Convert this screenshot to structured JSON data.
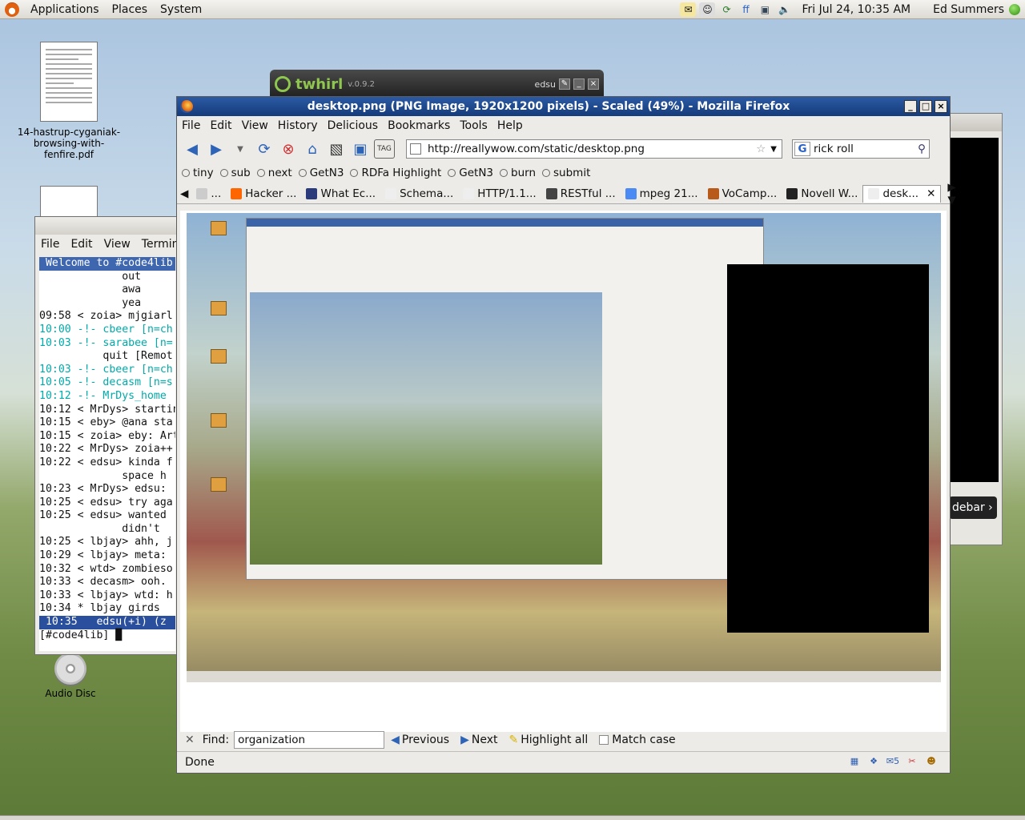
{
  "top_panel": {
    "menus": [
      "Applications",
      "Places",
      "System"
    ],
    "clock": "Fri Jul 24, 10:35 AM",
    "user": "Ed Summers"
  },
  "desktop": {
    "icons": [
      {
        "label": "14-hastrup-cyganiak-browsing-with-fenfire.pdf",
        "icon": "pdf-document-icon"
      },
      {
        "label": "Audio Disc",
        "icon": "audio-disc-icon"
      }
    ]
  },
  "twhirl": {
    "name": "twhirl",
    "version": "v.0.9.2",
    "account": "edsu"
  },
  "terminal": {
    "menus": [
      "File",
      "Edit",
      "View",
      "Terminal"
    ],
    "lines": [
      {
        "cls": "hdr",
        "text": " Welcome to #code4lib"
      },
      {
        "cls": "",
        "text": "             out"
      },
      {
        "cls": "",
        "text": "             awa"
      },
      {
        "cls": "",
        "text": "             yea"
      },
      {
        "cls": "",
        "text": "09:58 < zoia> mjgiarl"
      },
      {
        "cls": "cyan",
        "text": "10:00 -!- cbeer [n=ch"
      },
      {
        "cls": "cyan",
        "text": "10:03 -!- sarabee [n="
      },
      {
        "cls": "",
        "text": "          quit [Remot"
      },
      {
        "cls": "cyan",
        "text": "10:03 -!- cbeer [n=ch"
      },
      {
        "cls": "cyan",
        "text": "10:05 -!- decasm [n=s"
      },
      {
        "cls": "cyan",
        "text": "10:12 -!- MrDys_home "
      },
      {
        "cls": "",
        "text": "10:12 < MrDys> startin"
      },
      {
        "cls": "",
        "text": "10:15 < eby> @ana sta"
      },
      {
        "cls": "",
        "text": "10:15 < zoia> eby: Art"
      },
      {
        "cls": "",
        "text": "10:22 < MrDys> zoia++"
      },
      {
        "cls": "",
        "text": "10:22 < edsu> kinda f"
      },
      {
        "cls": "",
        "text": "             space h"
      },
      {
        "cls": "",
        "text": "10:23 < MrDys> edsu: "
      },
      {
        "cls": "",
        "text": "10:25 < edsu> try aga"
      },
      {
        "cls": "",
        "text": "10:25 < edsu> wanted "
      },
      {
        "cls": "",
        "text": "             didn't "
      },
      {
        "cls": "",
        "text": "10:25 < lbjay> ahh, j"
      },
      {
        "cls": "",
        "text": "10:29 < lbjay> meta: "
      },
      {
        "cls": "",
        "text": "10:32 < wtd> zombieso"
      },
      {
        "cls": "",
        "text": "10:33 < decasm> ooh. "
      },
      {
        "cls": "",
        "text": "10:33 < lbjay> wtd: h"
      },
      {
        "cls": "",
        "text": "10:34 * lbjay girds "
      },
      {
        "cls": "status",
        "text": " 10:35   edsu(+i) (z"
      },
      {
        "cls": "",
        "text": "[#code4lib] █"
      }
    ]
  },
  "firefox": {
    "title": "desktop.png (PNG Image, 1920x1200 pixels) - Scaled (49%) - Mozilla Firefox",
    "menus": [
      "File",
      "Edit",
      "View",
      "History",
      "Delicious",
      "Bookmarks",
      "Tools",
      "Help"
    ],
    "url": "http://reallywow.com/static/desktop.png",
    "search": "rick roll",
    "bookmarks": [
      "tiny",
      "sub",
      "next",
      "GetN3",
      "RDFa Highlight",
      "GetN3",
      "burn",
      "submit"
    ],
    "tabs": [
      {
        "label": "...",
        "color": "#cccccc"
      },
      {
        "label": "Hacker ...",
        "color": "#ff6600"
      },
      {
        "label": "What Ec...",
        "color": "#2a3a7a"
      },
      {
        "label": "Schema...",
        "color": "#eeeeee"
      },
      {
        "label": "HTTP/1.1...",
        "color": "#eeeeee"
      },
      {
        "label": "RESTful ...",
        "color": "#444444"
      },
      {
        "label": "mpeg 21...",
        "color": "#4a8af4"
      },
      {
        "label": "VoCamp...",
        "color": "#b85a1a"
      },
      {
        "label": "Novell W...",
        "color": "#222222"
      },
      {
        "label": "desk...",
        "color": "#eeeeee"
      }
    ],
    "find": {
      "label": "Find:",
      "value": "organization",
      "previous": "Previous",
      "next": "Next",
      "highlight": "Highlight all",
      "match_case": "Match case"
    },
    "status": "Done",
    "mail_count": "5"
  },
  "back_window": {
    "button": "debar"
  }
}
